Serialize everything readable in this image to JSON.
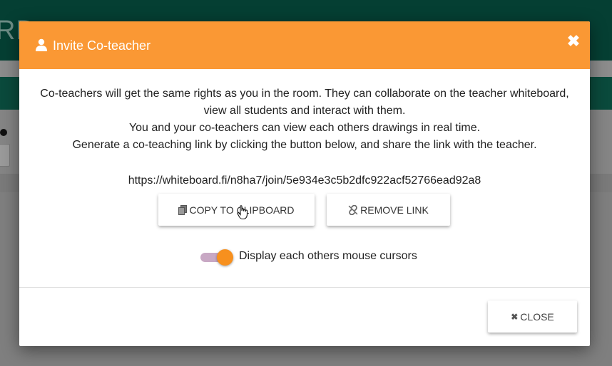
{
  "background": {
    "logo_fragment": "RD"
  },
  "modal": {
    "title": "Invite Co-teacher",
    "close_glyph": "✖",
    "description": [
      "Co-teachers will get the same rights as you in the room. They can collaborate on the teacher whiteboard, view all students and interact with them.",
      "You and your co-teachers can view each others drawings in real time.",
      "Generate a co-teaching link by clicking the button below, and share the link with the teacher."
    ],
    "invite_link": "https://whiteboard.fi/n8ha7/join/5e934e3c5b2dfc922acf52766ead92a8",
    "copy_button": {
      "label": "COPY TO CLIPBOARD",
      "icon": "copy-icon"
    },
    "remove_button": {
      "label": "REMOVE LINK",
      "icon": "unlink-icon"
    },
    "cursor_toggle": {
      "label": "Display each others mouse cursors",
      "on": true
    },
    "close_button": {
      "label": "CLOSE",
      "glyph": "✖"
    }
  },
  "colors": {
    "header": "#fa9834",
    "toggle_knob": "#f7901e",
    "toggle_track": "#c8a8c4",
    "topbar": "#053f33"
  }
}
